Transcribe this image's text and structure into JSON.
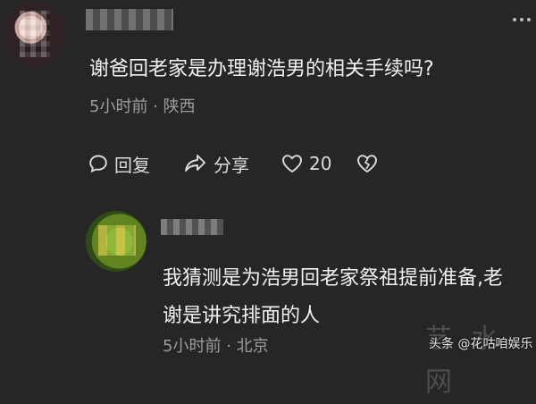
{
  "comment": {
    "username": "Łıе快乐ĵ",
    "text": "谢爸回老家是办理谢浩男的相关手续吗?",
    "time": "5小时前",
    "location": "陕西",
    "meta_sep": "·",
    "actions": {
      "reply_label": "回复",
      "share_label": "分享",
      "like_count": "20"
    }
  },
  "reply": {
    "text": "我猜测是为浩男回老家祭祖提前准备,老谢是讲究排面的人",
    "time": "5小时前",
    "location": "北京",
    "meta_sep": "·"
  },
  "watermark": {
    "text": "头条 @花咕咱娱乐",
    "background_text": "艺 水 网"
  },
  "colors": {
    "background": "#262626",
    "text": "#f2f2f2",
    "meta": "#9c9c9c"
  }
}
